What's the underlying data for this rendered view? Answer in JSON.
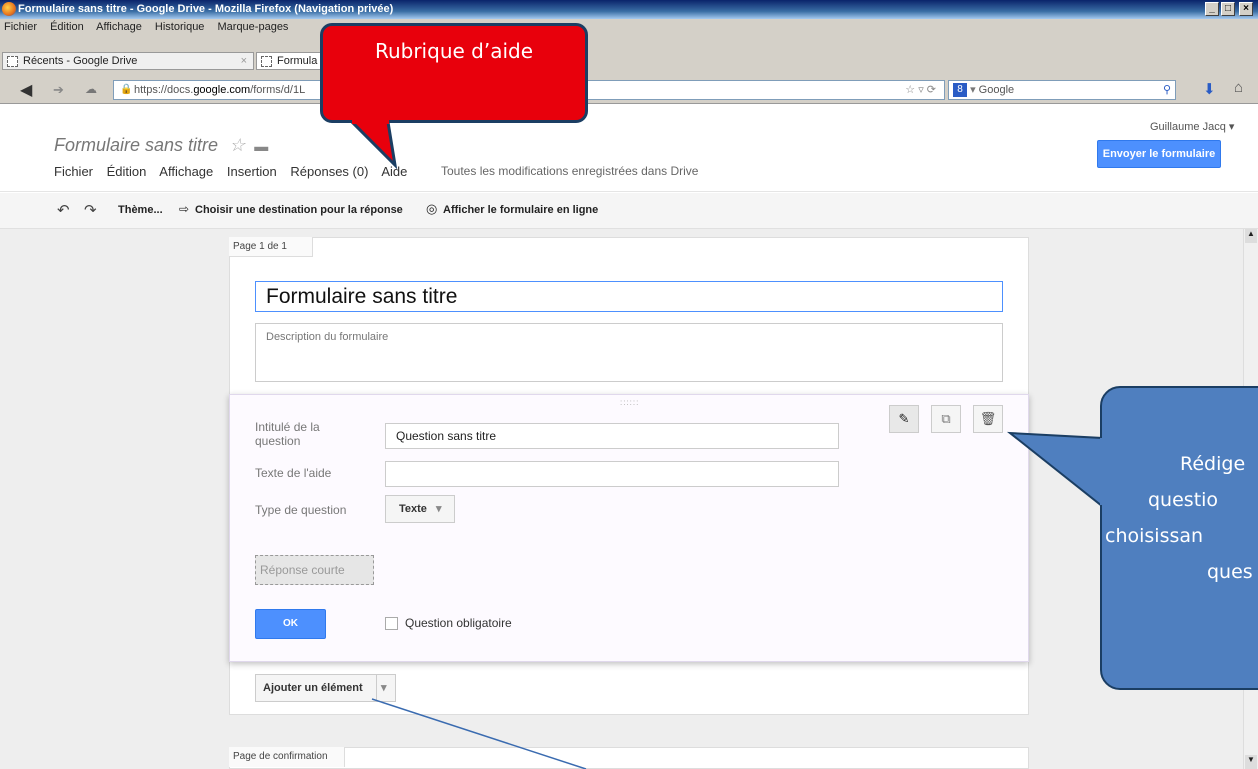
{
  "window": {
    "title": "Formulaire sans titre - Google Drive - Mozilla Firefox (Navigation privée)",
    "controls": [
      "_",
      "□",
      "×"
    ]
  },
  "menubar": [
    "Fichier",
    "Édition",
    "Affichage",
    "Historique",
    "Marque-pages"
  ],
  "tabs": [
    {
      "label": "Récents - Google Drive"
    },
    {
      "label": "Formula"
    }
  ],
  "address": {
    "url_prefix": "https://docs.",
    "url_domain": "google.com",
    "url_rest": "/forms/d/1L",
    "search_engine": "Google"
  },
  "doc": {
    "title": "Formulaire sans titre",
    "menu": [
      "Fichier",
      "Édition",
      "Affichage",
      "Insertion",
      "Réponses (0)",
      "Aide"
    ],
    "save_status": "Toutes les modifications enregistrées dans Drive",
    "user": "Guillaume Jacq",
    "send_button": "Envoyer le formulaire"
  },
  "toolbar": {
    "theme": "Thème...",
    "destination": "Choisir une destination pour la réponse",
    "view_live": "Afficher le formulaire en ligne"
  },
  "form": {
    "page_label": "Page 1 de 1",
    "title": "Formulaire sans titre",
    "description_placeholder": "Description du formulaire",
    "question": {
      "title_label": "Intitulé de la question",
      "title_value": "Question sans titre",
      "help_label": "Texte de l'aide",
      "help_value": "",
      "type_label": "Type de question",
      "type_value": "Texte",
      "short_answer": "Réponse courte",
      "ok": "OK",
      "required": "Question obligatoire",
      "drag_handle": "::::::"
    },
    "add_element": "Ajouter un élément",
    "confirmation_label": "Page de confirmation"
  },
  "callouts": {
    "help": "Rubrique d’aide",
    "write": [
      "Rédige",
      "questio",
      "choisissan",
      "ques"
    ]
  },
  "colors": {
    "blue_button": "#4d90fe",
    "red_callout": "#e8000c",
    "blue_callout": "#4f7fbf"
  }
}
